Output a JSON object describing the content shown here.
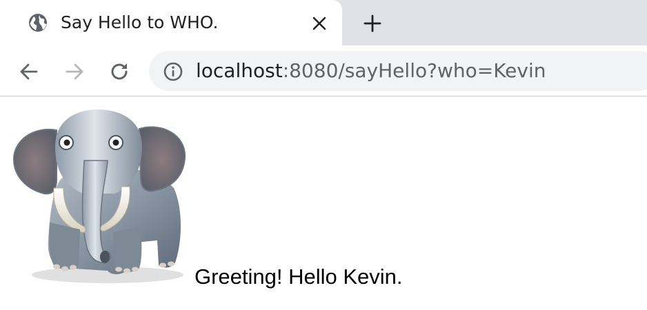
{
  "tab": {
    "title": "Say Hello to WHO.",
    "favicon": "globe-icon",
    "close_icon": "close-icon"
  },
  "tabstrip": {
    "new_tab_icon": "plus-icon"
  },
  "toolbar": {
    "back_icon": "arrow-left-icon",
    "forward_icon": "arrow-right-icon",
    "reload_icon": "reload-icon",
    "site_info_icon": "info-icon"
  },
  "omnibox": {
    "url_host": "localhost",
    "url_rest": ":8080/sayHello?who=Kevin"
  },
  "page": {
    "image": "elephant-image",
    "greeting": "Greeting! Hello Kevin."
  },
  "colors": {
    "tabstrip_bg": "#dee1e6",
    "omnibox_bg": "#f1f3f4",
    "url_host": "#202124",
    "url_rest": "#5f6368",
    "icon": "#5f6368",
    "icon_disabled": "#b4b6b8"
  }
}
